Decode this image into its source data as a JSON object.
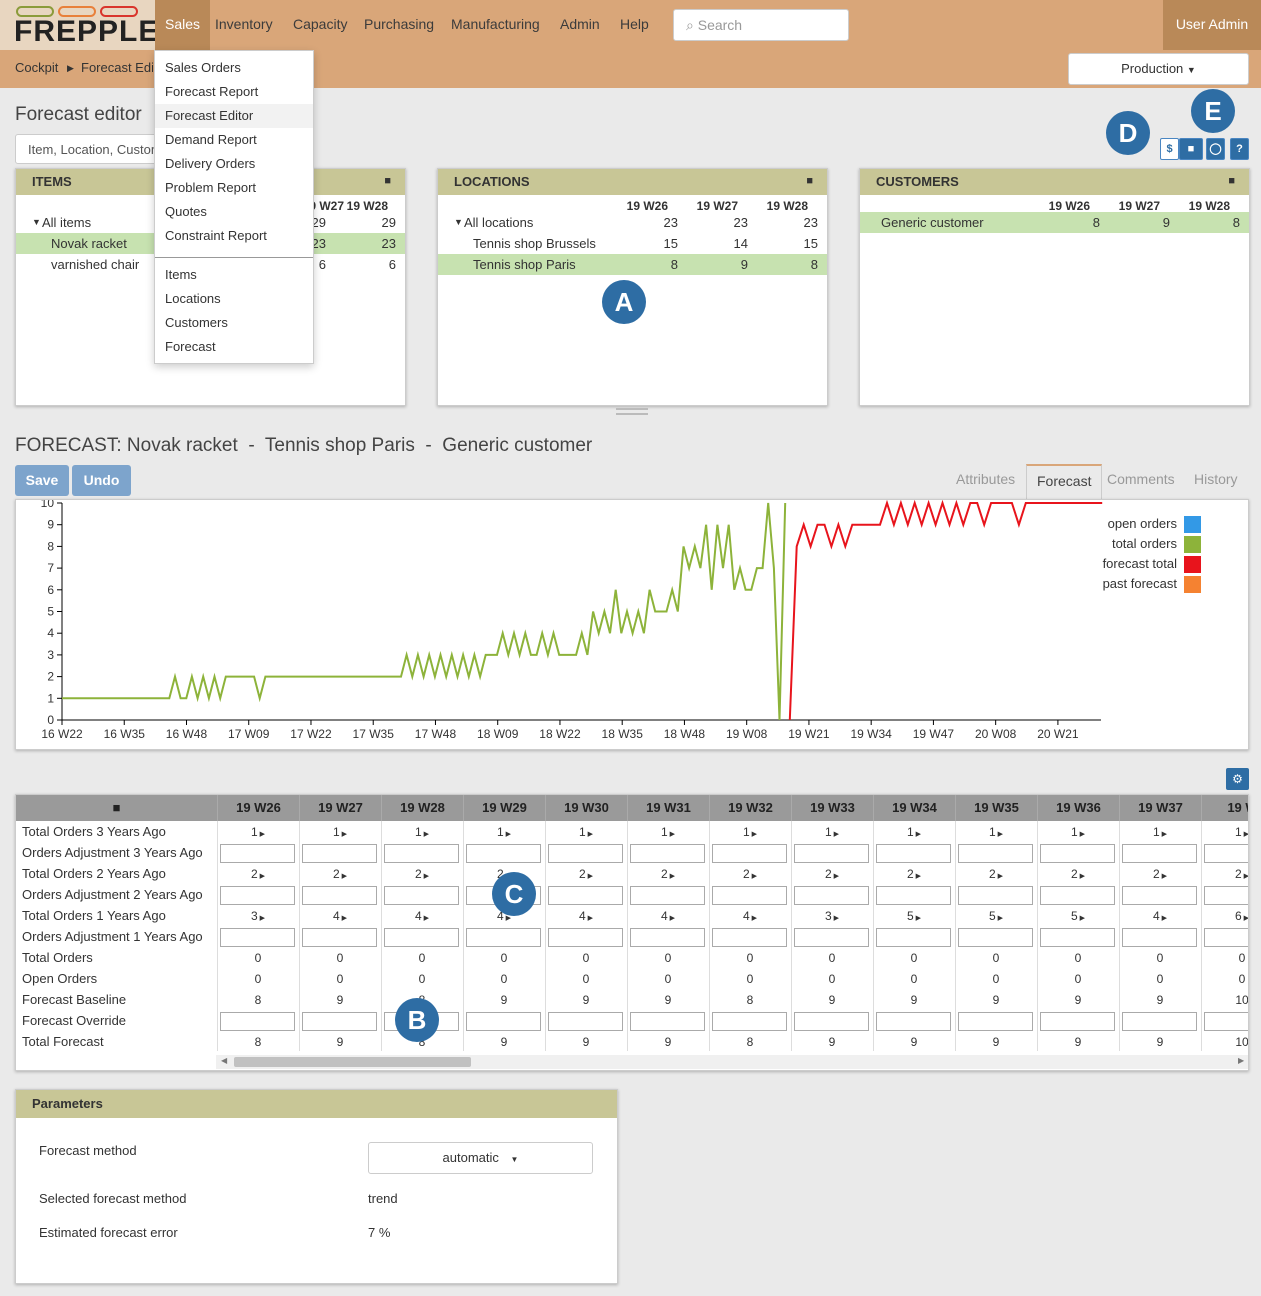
{
  "app": {
    "logo": "FREPPLE",
    "user": "User Admin"
  },
  "nav": {
    "sales": "Sales",
    "inventory": "Inventory",
    "capacity": "Capacity",
    "purchasing": "Purchasing",
    "manufacturing": "Manufacturing",
    "admin": "Admin",
    "help": "Help"
  },
  "search": {
    "placeholder": "Search"
  },
  "breadcrumb": {
    "home": "Cockpit",
    "current": "Forecast Editor"
  },
  "scenario": {
    "label": "Production"
  },
  "menu": {
    "items": [
      "Sales Orders",
      "Forecast Report",
      "Forecast Editor",
      "Demand Report",
      "Delivery Orders",
      "Problem Report",
      "Quotes",
      "Constraint Report"
    ],
    "items2": [
      "Items",
      "Locations",
      "Customers",
      "Forecast"
    ]
  },
  "page": {
    "title": "Forecast editor",
    "selector": "Item, Location, Customer"
  },
  "toolbar": {
    "currency": "$",
    "help": "?"
  },
  "markers": {
    "a": "A",
    "b": "B",
    "c": "C",
    "d": "D",
    "e": "E"
  },
  "panels": {
    "items": {
      "title": "ITEMS",
      "cols": [
        "19 W27",
        "19 W28"
      ],
      "rows": [
        {
          "name": "All items",
          "v": [
            "29",
            "29"
          ]
        },
        {
          "name": "Novak racket",
          "v": [
            "23",
            "23"
          ]
        },
        {
          "name": "varnished chair",
          "v": [
            "6",
            "6"
          ]
        }
      ]
    },
    "locations": {
      "title": "LOCATIONS",
      "cols": [
        "19 W26",
        "19 W27",
        "19 W28"
      ],
      "rows": [
        {
          "name": "All locations",
          "v": [
            "23",
            "23",
            "23"
          ]
        },
        {
          "name": "Tennis shop Brussels",
          "v": [
            "15",
            "14",
            "15"
          ]
        },
        {
          "name": "Tennis shop Paris",
          "v": [
            "8",
            "9",
            "8"
          ]
        }
      ]
    },
    "customers": {
      "title": "CUSTOMERS",
      "cols": [
        "19 W26",
        "19 W27",
        "19 W28"
      ],
      "rows": [
        {
          "name": "Generic customer",
          "v": [
            "8",
            "9",
            "8"
          ]
        }
      ]
    }
  },
  "forecast": {
    "title": "FORECAST: Novak racket  -  Tennis shop Paris  -  Generic customer",
    "save": "Save",
    "undo": "Undo",
    "tabs": [
      "Attributes",
      "Forecast",
      "Comments",
      "History"
    ]
  },
  "chart_data": {
    "type": "line",
    "title": "",
    "x_labels": [
      "16 W22",
      "16 W35",
      "16 W48",
      "17 W09",
      "17 W22",
      "17 W35",
      "17 W48",
      "18 W09",
      "18 W22",
      "18 W35",
      "18 W48",
      "19 W08",
      "19 W21",
      "19 W34",
      "19 W47",
      "20 W08",
      "20 W21"
    ],
    "y_ticks": [
      0,
      1,
      2,
      3,
      4,
      5,
      6,
      7,
      8,
      9,
      10
    ],
    "ylim": [
      0,
      10
    ],
    "legend": [
      {
        "name": "open orders",
        "color": "#3399e6"
      },
      {
        "name": "total orders",
        "color": "#8db33a"
      },
      {
        "name": "forecast total",
        "color": "#e8141c"
      },
      {
        "name": "past forecast",
        "color": "#f58231"
      }
    ],
    "series": [
      {
        "name": "total orders",
        "color": "#8db33a",
        "x_start": "16 W22",
        "values": [
          1,
          1,
          1,
          1,
          1,
          1,
          1,
          1,
          1,
          1,
          1,
          1,
          1,
          1,
          1,
          1,
          1,
          1,
          1,
          1,
          2,
          1,
          1,
          2,
          1,
          2,
          1,
          2,
          1,
          2,
          2,
          2,
          2,
          2,
          2,
          1,
          2,
          2,
          2,
          2,
          2,
          2,
          2,
          2,
          2,
          2,
          2,
          2,
          2,
          2,
          2,
          2,
          2,
          2,
          2,
          2,
          2,
          2,
          2,
          2,
          2,
          3,
          2,
          3,
          2,
          3,
          2,
          3,
          2,
          3,
          2,
          3,
          2,
          3,
          2,
          3,
          3,
          3,
          4,
          3,
          4,
          3,
          4,
          3,
          3,
          4,
          3,
          4,
          3,
          3,
          3,
          3,
          4,
          3,
          5,
          4,
          5,
          4,
          6,
          4,
          5,
          4,
          5,
          4,
          6,
          5,
          5,
          5,
          6,
          5,
          8,
          7,
          8,
          7,
          9,
          6,
          9,
          7,
          9,
          6,
          7,
          6,
          6,
          7,
          7,
          10,
          7,
          0,
          10
        ]
      },
      {
        "name": "forecast total",
        "color": "#e8141c",
        "x_start": "19 W26",
        "values": [
          0,
          8,
          9,
          8,
          9,
          9,
          8,
          9,
          8,
          9,
          9,
          9,
          9,
          9,
          10,
          9,
          10,
          9,
          10,
          9,
          10,
          9,
          10,
          9,
          10,
          9,
          10,
          10,
          9,
          10,
          10,
          10,
          10,
          9,
          10,
          10,
          10,
          10,
          10,
          10,
          10,
          10,
          10,
          10,
          10,
          10
        ]
      }
    ]
  },
  "grid": {
    "cols": [
      "19 W26",
      "19 W27",
      "19 W28",
      "19 W29",
      "19 W30",
      "19 W31",
      "19 W32",
      "19 W33",
      "19 W34",
      "19 W35",
      "19 W36",
      "19 W37",
      "19 W"
    ],
    "rows": [
      {
        "label": "Total Orders 3 Years Ago",
        "type": "arrow",
        "v": [
          "1",
          "1",
          "1",
          "1",
          "1",
          "1",
          "1",
          "1",
          "1",
          "1",
          "1",
          "1",
          "1"
        ]
      },
      {
        "label": "Orders Adjustment 3 Years Ago",
        "type": "input"
      },
      {
        "label": "Total Orders 2 Years Ago",
        "type": "arrow",
        "v": [
          "2",
          "2",
          "2",
          "2",
          "2",
          "2",
          "2",
          "2",
          "2",
          "2",
          "2",
          "2",
          "2"
        ]
      },
      {
        "label": "Orders Adjustment 2 Years Ago",
        "type": "input"
      },
      {
        "label": "Total Orders 1 Years Ago",
        "type": "arrow",
        "v": [
          "3",
          "4",
          "4",
          "4",
          "4",
          "4",
          "4",
          "3",
          "5",
          "5",
          "5",
          "4",
          "6"
        ]
      },
      {
        "label": "Orders Adjustment 1 Years Ago",
        "type": "input"
      },
      {
        "label": "Total Orders",
        "type": "value",
        "v": [
          "0",
          "0",
          "0",
          "0",
          "0",
          "0",
          "0",
          "0",
          "0",
          "0",
          "0",
          "0",
          "0"
        ]
      },
      {
        "label": "Open Orders",
        "type": "value",
        "v": [
          "0",
          "0",
          "0",
          "0",
          "0",
          "0",
          "0",
          "0",
          "0",
          "0",
          "0",
          "0",
          "0"
        ]
      },
      {
        "label": "Forecast Baseline",
        "type": "value",
        "v": [
          "8",
          "9",
          "8",
          "9",
          "9",
          "9",
          "8",
          "9",
          "9",
          "9",
          "9",
          "9",
          "10"
        ]
      },
      {
        "label": "Forecast Override",
        "type": "input"
      },
      {
        "label": "Total Forecast",
        "type": "value",
        "v": [
          "8",
          "9",
          "8",
          "9",
          "9",
          "9",
          "8",
          "9",
          "9",
          "9",
          "9",
          "9",
          "10"
        ]
      }
    ]
  },
  "parameters": {
    "title": "Parameters",
    "method_label": "Forecast method",
    "method_value": "automatic",
    "selected_label": "Selected forecast method",
    "selected_value": "trend",
    "error_label": "Estimated forecast error",
    "error_value": "7 %"
  }
}
